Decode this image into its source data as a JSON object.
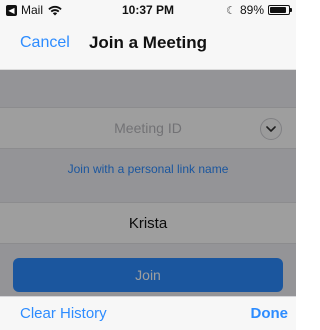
{
  "status_bar": {
    "back_app": "Mail",
    "time": "10:37 PM",
    "battery_percent_label": "89%",
    "battery_level": 0.89
  },
  "nav": {
    "cancel": "Cancel",
    "title": "Join a Meeting"
  },
  "form": {
    "meeting_id_placeholder": "Meeting ID",
    "personal_link": "Join with a personal link name",
    "name_value": "Krista",
    "join_label": "Join"
  },
  "accessory": {
    "clear_history": "Clear History",
    "done": "Done"
  },
  "colors": {
    "accent": "#2d8cff",
    "overlay": "rgba(0,0,0,0.38)"
  },
  "icons": {
    "back": "back-to-app-icon",
    "wifi": "wifi-icon",
    "moon": "do-not-disturb-icon",
    "battery": "battery-icon",
    "dropdown": "chevron-down-icon"
  }
}
